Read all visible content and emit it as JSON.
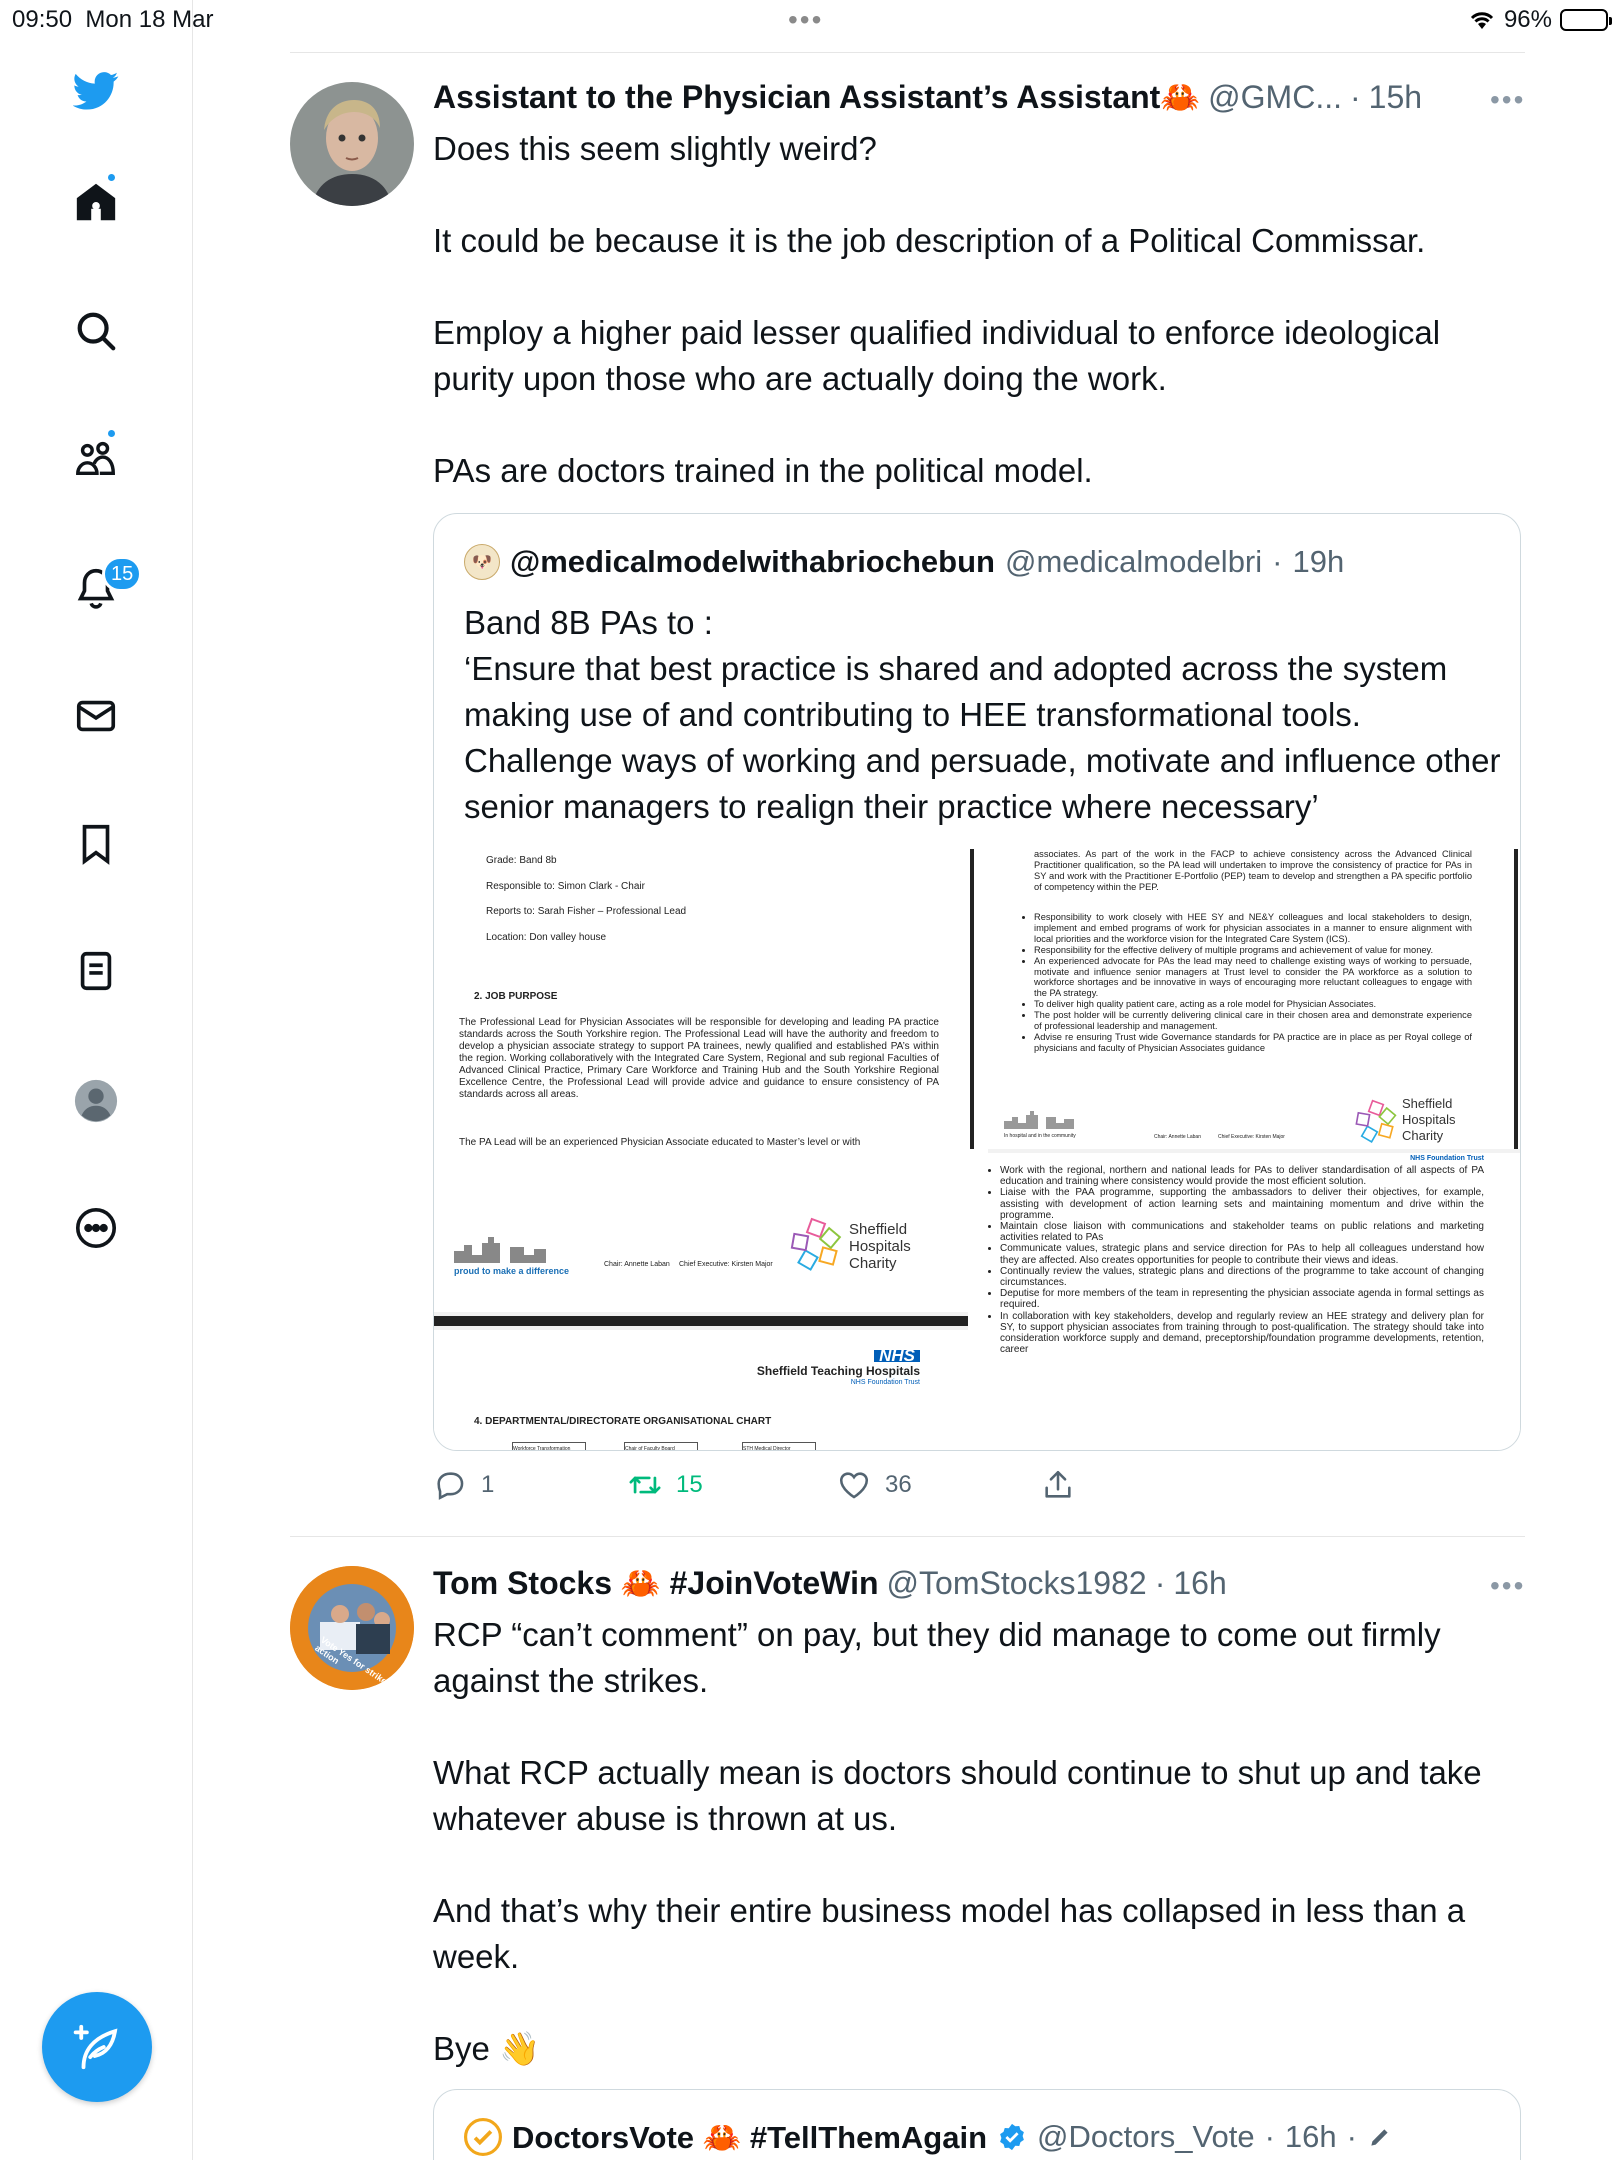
{
  "status": {
    "time": "09:50",
    "date": "Mon 18 Mar",
    "battery": "96%",
    "battery_level": 0.96
  },
  "sidebar": {
    "notification_count": "15"
  },
  "tweets": [
    {
      "name": "Assistant to the Physician Assistant’s Assistant",
      "name_emoji": "🦀",
      "handle": "@GMC...",
      "dot": "·",
      "time": "15h",
      "paragraphs": [
        "Does this seem slightly weird?",
        "It could be because it is the job description of a Political Commissar.",
        "Employ a higher paid lesser qualified individual to enforce ideological purity upon those who are actually doing the work.",
        "PAs are doctors trained in the political model."
      ],
      "quote": {
        "name": "@medicalmodelwithabriochebun",
        "handle": "@medicalmodelbri",
        "time": "19h",
        "lines": [
          "Band 8B PAs to :",
          "‘Ensure that best practice is shared and adopted across the system making use of and contributing to HEE transformational tools. Challenge ways of working and persuade, motivate and influence other senior managers to realign their practice where necessary’"
        ],
        "doc_left": {
          "grade": "Grade: Band 8b",
          "responsible": "Responsible to: Simon Clark - Chair",
          "reports": "Reports to: Sarah Fisher – Professional Lead",
          "location": "Location: Don valley house",
          "heading": "2.   JOB PURPOSE",
          "purpose": "The Professional Lead for Physician Associates will be responsible for developing and leading PA practice standards across the South Yorkshire region. The Professional Lead will have the authority and freedom to develop a physician associate strategy to support PA trainees, newly qualified and established PA’s within the region. Working collaboratively with the Integrated Care System, Regional and sub regional Faculties of Advanced Clinical Practice, Primary Care Workforce and Training Hub and the South Yorkshire Regional Excellence Centre, the Professional Lead will provide advice and guidance to ensure consistency of PA standards across all areas.",
          "pa_lead": "The PA Lead will be an experienced Physician Associate educated to Master’s level or with",
          "footer_chair": "Chair: Annette Laban",
          "footer_ce": "Chief Executive: Kirsten Major",
          "proud": "proud to make a difference",
          "charity": "Sheffield\nHospitals\nCharity",
          "nhs": "NHS",
          "trust": "Sheffield Teaching Hospitals",
          "trust_sub": "NHS Foundation Trust",
          "chart_heading": "4.   DEPARTMENTAL/DIRECTORATE ORGANISATIONAL CHART",
          "chart_boxes": [
            "Workforce Transformation",
            "Chair of Faculty Board",
            "STH Medical Director"
          ]
        },
        "doc_right_top": {
          "intro": "associates. As part of the work in the FACP to achieve consistency across the Advanced Clinical Practitioner qualification, so the PA lead will undertaken to improve the consistency of practice for PAs in SY and work with the Practitioner E-Portfolio (PEP) team to develop and strengthen a PA specific portfolio of competency within the PEP.",
          "bullets": [
            "Responsibility to work closely with HEE SY and NE&Y colleagues and local stakeholders to design, implement and embed programs of work for physician associates in a manner to ensure alignment with local priorities and the workforce vision for the Integrated Care System (ICS).",
            "Responsibility for the effective delivery of multiple programs and achievement of value for money.",
            "An experienced advocate for PAs the lead may need to challenge existing ways of working to persuade, motivate and influence senior managers at Trust level to consider the PA workforce as a solution to workforce shortages and be innovative in ways of encouraging more reluctant colleagues to engage with the PA strategy.",
            "To deliver high quality patient care, acting as a role model for Physician Associates.",
            "The post holder will be currently delivering clinical care in their chosen area and demonstrate experience of professional leadership and management.",
            "Advise re ensuring Trust wide Governance standards for PA practice are in place as per Royal college of physicians and faculty of Physician Associates guidance"
          ],
          "footer_left": "In hospital and in the community",
          "footer_chair": "Chair: Annette Laban",
          "footer_ce": "Chief Executive: Kirsten Major",
          "charity": "Sheffield\nHospitals\nCharity"
        },
        "doc_right_bottom": {
          "trust_sub": "NHS Foundation Trust",
          "bullets": [
            "Work with the regional, northern and national leads for PAs to deliver standardisation of all aspects of PA education and training where consistency would provide the most efficient solution.",
            "Liaise with the PAA programme, supporting the ambassadors to deliver their objectives, for example, assisting with development of action learning sets and maintaining momentum and drive within the programme.",
            "Maintain close liaison with communications and stakeholder teams on public relations and marketing activities related to PAs",
            "Communicate values, strategic plans and service direction for PAs to help all colleagues understand how they are affected. Also creates opportunities for people to contribute their views and ideas.",
            "Continually review the values, strategic plans and directions of the programme to take account of changing circumstances.",
            "Deputise for more members of the team in representing the physician associate agenda in formal settings as required.",
            "In collaboration with key stakeholders, develop and regularly review an HEE strategy and delivery plan for SY, to support physician associates from training through to post-qualification. The strategy should take into consideration workforce supply and demand, preceptorship/foundation programme developments, retention, career"
          ]
        }
      },
      "actions": {
        "replies": "1",
        "retweets": "15",
        "likes": "36"
      }
    },
    {
      "name": "Tom Stocks",
      "name_emoji": "🦀",
      "name_tag": "#JoinVoteWin",
      "handle": "@TomStocks1982",
      "dot": "·",
      "time": "16h",
      "paragraphs": [
        "RCP “can’t comment” on pay, but they did manage to come out firmly against the strikes.",
        "What RCP actually mean is doctors should continue to shut up and take whatever abuse is thrown at us.",
        "And that’s why their entire business model has collapsed in less than a week.",
        "Bye 👋"
      ],
      "avatar_text_top": "#BMABallotReady",
      "avatar_text_bottom": "Vote Yes for strike action",
      "quote": {
        "name": "DoctorsVote",
        "name_emoji": "🦀",
        "name_tag": "#TellThemAgain",
        "handle": "@Doctors_Vote",
        "time": "16h"
      }
    }
  ],
  "colors": {
    "accent": "#1d9bf0",
    "retweet": "#00ba7c",
    "muted": "#536471",
    "nhs": "#005eb8"
  },
  "icons": [
    "twitter-logo-icon",
    "home-icon",
    "search-icon",
    "communities-icon",
    "bell-icon",
    "mail-icon",
    "bookmark-icon",
    "lists-icon",
    "profile-icon",
    "more-icon",
    "compose-icon",
    "reply-icon",
    "retweet-icon",
    "like-icon",
    "share-icon",
    "verified-icon",
    "wifi-icon"
  ]
}
